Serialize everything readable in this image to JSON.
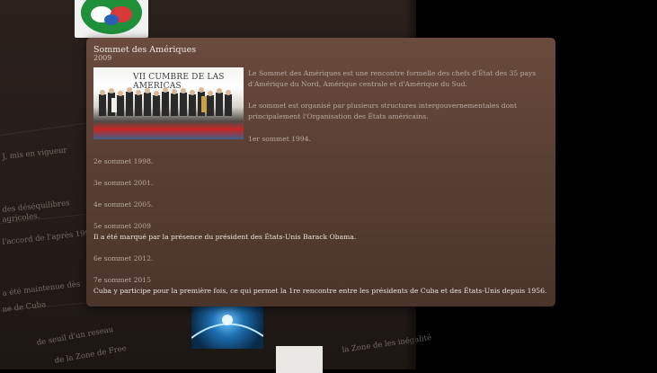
{
  "popup": {
    "title": "Sommet des Amériques",
    "year": "2009",
    "photo_banner": "VII CUMBRE DE LAS AMERICAS",
    "intro": "Le Sommet des Amériques est une rencontre formelle des chefs d'État des 35 pays d'Amérique du Nord, Amérique centrale et d'Amérique du Sud.",
    "organisation": "Le sommet est organisé par plusieurs structures intergouvernementales dont principalement l'Organisation des États américains.",
    "summits": [
      {
        "label": "1er sommet 1994.",
        "desc": ""
      },
      {
        "label": "2e sommet 1998.",
        "desc": ""
      },
      {
        "label": "3e sommet 2001.",
        "desc": ""
      },
      {
        "label": "4e sommet 2005.",
        "desc": ""
      },
      {
        "label": "5e sommet 2009",
        "desc": "Il a été marqué par la présence du président des États-Unis Barack Obama."
      },
      {
        "label": "6e sommet 2012.",
        "desc": ""
      },
      {
        "label": "7e sommet 2015",
        "desc": "Cuba y participe pour la première fois, ce qui permet la 1re rencontre entre les présidents de Cuba et des États-Unis depuis 1956."
      }
    ]
  },
  "background": {
    "snippets": [
      "J, mis en vigueur",
      "des déséquilibres",
      "agricoles.",
      "l'accord de l'après 1992",
      "a été maintenue dès",
      "ne de Cuba",
      "de seuil d'un reseau",
      "de la Zone de Free",
      "la Zone de les inégalité"
    ]
  }
}
